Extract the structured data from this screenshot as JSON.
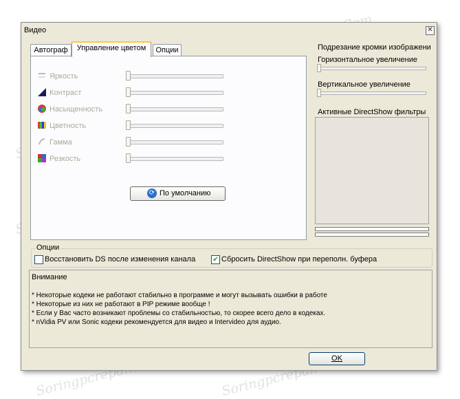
{
  "window": {
    "title": "Видео",
    "close_glyph": "✕"
  },
  "tabs": [
    {
      "label": "Автограф",
      "active": false
    },
    {
      "label": "Управление цветом",
      "active": true
    },
    {
      "label": "Опции",
      "active": false
    }
  ],
  "adjustments": [
    {
      "label": "Яркость",
      "icon": "brightness-icon"
    },
    {
      "label": "Контраст",
      "icon": "contrast-icon"
    },
    {
      "label": "Насыщенность",
      "icon": "saturation-icon"
    },
    {
      "label": "Цветность",
      "icon": "hue-icon"
    },
    {
      "label": "Гамма",
      "icon": "gamma-icon"
    },
    {
      "label": "Резкость",
      "icon": "sharpness-icon"
    }
  ],
  "default_button": "По умолчанию",
  "crop": {
    "heading": "Подрезание кромки изображени",
    "horizontal": "Горизонтальное увеличение",
    "vertical": "Вертикальное увеличение"
  },
  "filters_label": "Активные DirectShow фильтры",
  "options": {
    "group_label": "Опции",
    "restore_ds": {
      "label": "Восстановить DS после изменения канала",
      "checked": false
    },
    "reset_ds": {
      "label": "Сбросить DirectShow при переполн. буфера",
      "checked": true
    }
  },
  "notes": {
    "heading": "Внимание",
    "lines": [
      "*  Некоторые кодеки не работают стабильно в программе и могут вызывать ошибки в работе",
      "*  Некоторые из них не работают в PIP режиме вообще !",
      "*  Если у Вас часто возникают проблемы со стабильностью, то скорее всего дело в кодеках.",
      "*  nVidia PV или Sonic кодеки рекомендуется для видео и Intervideo для аудио."
    ]
  },
  "ok_button": "OK",
  "watermark": "Soringpcrepair.Com",
  "colors": {
    "window_bg": "#ece9d8",
    "tab_accent": "#ffc83c",
    "checkbox_check": "#21a121"
  }
}
